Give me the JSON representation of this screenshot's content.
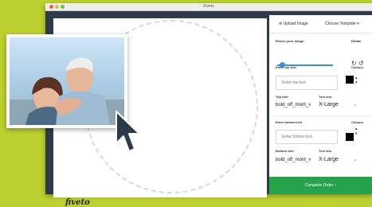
{
  "window": {
    "title": "Fiveto"
  },
  "canvas": {
    "logo": "fiveto"
  },
  "panel": {
    "tabs": {
      "upload": "⊕ Upload Image",
      "template": "Choose Template ▾"
    },
    "resize_label": "Resize your image",
    "rotate_label": "Rotate",
    "rotate_icons": "↻ ↺",
    "resize_slider": {
      "value_fraction": 0.08
    },
    "top": {
      "text_label": "Enter top text",
      "colours_label": "Colours",
      "placeholder": "Enter top text",
      "font_label": "Top font",
      "size_label": "Text size",
      "font_value": "bold_off_mont_v",
      "size_value": "X-Large"
    },
    "bottom": {
      "text_label": "Enter bottom text",
      "colours_label": "Colours",
      "placeholder": "Enter bottom text",
      "font_label": "Bottom font",
      "size_label": "Text size",
      "font_value": "bold_off_mont_v",
      "size_value": "X-Large"
    },
    "complete_button": "Complete Order ↑"
  },
  "colors": {
    "background": "#bcd12f",
    "window_dark": "#2f3b4a",
    "accent_blue": "#3a90dd",
    "cta_green": "#25a24a",
    "swatch": "#000000"
  },
  "icons": [
    "rotate-cw-icon",
    "rotate-ccw-icon",
    "chevron-down-icon",
    "pointer-cursor-icon"
  ]
}
